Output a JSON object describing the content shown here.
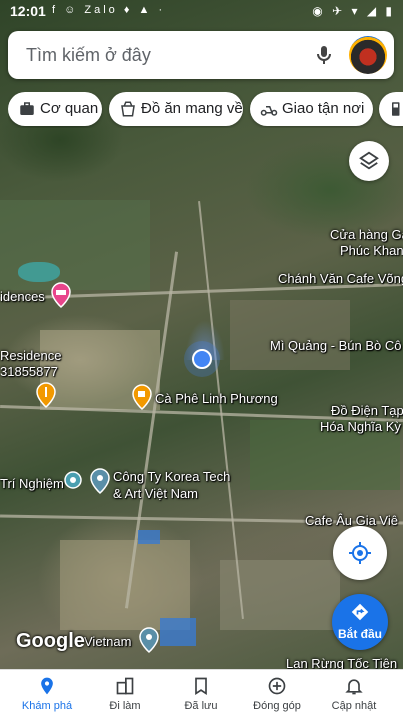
{
  "status_bar": {
    "time": "12:01",
    "left_icons": "f ☺ Zalo ♦ ▲ ·",
    "right_icons": "◉ ✈ ▾ ◢ ▮"
  },
  "search": {
    "placeholder": "Tìm kiếm ở đây",
    "icon": "mic-icon"
  },
  "chips": [
    {
      "label": "Cơ quan",
      "icon": "briefcase-icon"
    },
    {
      "label": "Đồ ăn mang về",
      "icon": "takeout-icon"
    },
    {
      "label": "Giao tận nơi",
      "icon": "scooter-icon"
    },
    {
      "label": "",
      "icon": "gas-station-icon"
    }
  ],
  "map_labels": [
    {
      "text": "Cửa hàng Ga",
      "icon": ""
    },
    {
      "text": "Phúc Khan",
      "icon": ""
    },
    {
      "text": "Chánh Văn Cafe Võng",
      "icon": ""
    },
    {
      "text": "idences",
      "icon": "hotel-icon"
    },
    {
      "text": "Mì Quảng - Bún Bò Cô",
      "icon": ""
    },
    {
      "text": "Residence",
      "icon": ""
    },
    {
      "text": "31855877",
      "icon": ""
    },
    {
      "text": "Cà Phê Linh Phương",
      "icon": "cafe-icon"
    },
    {
      "text": "Đồ Điện Tạp",
      "icon": ""
    },
    {
      "text": "Hóa Nghĩa Kỳ",
      "icon": ""
    },
    {
      "text": "Trí Nghiệm",
      "icon": ""
    },
    {
      "text": "Công Ty Korea Tech",
      "icon": ""
    },
    {
      "text": "& Art Việt Nam",
      "icon": ""
    },
    {
      "text": "Cafe Âu Gia Viê",
      "icon": ""
    },
    {
      "text": "Vietnam",
      "icon": ""
    },
    {
      "text": "Lan Rừng Tốc Tiên",
      "icon": ""
    }
  ],
  "google_logo": "Google",
  "start_button": {
    "label": "Bắt đầu",
    "icon": "directions-icon"
  },
  "bottom_nav": [
    {
      "label": "Khám phá",
      "icon": "explore-pin-icon",
      "active": true
    },
    {
      "label": "Đi làm",
      "icon": "commute-icon",
      "active": false
    },
    {
      "label": "Đã lưu",
      "icon": "bookmark-icon",
      "active": false
    },
    {
      "label": "Đóng góp",
      "icon": "add-circle-icon",
      "active": false
    },
    {
      "label": "Cập nhật",
      "icon": "bell-icon",
      "active": false
    }
  ],
  "colors": {
    "accent": "#1a73e8",
    "pin_red": "#ea4335",
    "pin_orange": "#f29900",
    "pin_teal": "#4a9fb0",
    "hotel_pink": "#e8458b"
  }
}
